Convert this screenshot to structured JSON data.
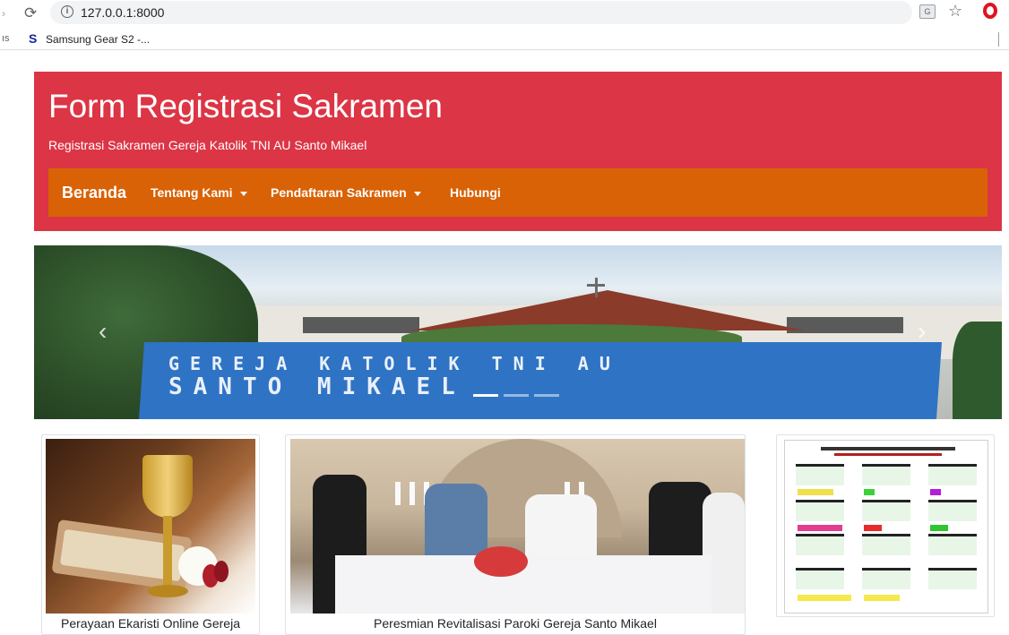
{
  "browser": {
    "url": "127.0.0.1:8000",
    "bookmarks_prefix": "ıs",
    "bookmark_favicon": "S",
    "bookmark_label": "Samsung Gear S2 -..."
  },
  "header": {
    "title": "Form Registrasi Sakramen",
    "subtitle": "Registrasi Sakramen Gereja Katolik TNI AU Santo Mikael",
    "background_color": "#dc3545"
  },
  "navbar": {
    "background_color": "#d96206",
    "brand": "Beranda",
    "items": [
      {
        "label": "Tentang Kami",
        "dropdown": true
      },
      {
        "label": "Pendaftaran Sakramen",
        "dropdown": true
      },
      {
        "label": "Hubungi",
        "dropdown": false
      }
    ]
  },
  "carousel": {
    "sign_line1": "GEREJA KATOLIK TNI AU",
    "sign_line2": "SANTO MIKAEL",
    "prev_icon": "chevron-left-icon",
    "next_icon": "chevron-right-icon",
    "slide_count": 3,
    "active_slide": 1
  },
  "cards": [
    {
      "caption": "Perayaan Ekaristi Online Gereja"
    },
    {
      "caption": "Peresmian Revitalisasi Paroki Gereja Santo Mikael"
    },
    {
      "caption": ""
    }
  ]
}
